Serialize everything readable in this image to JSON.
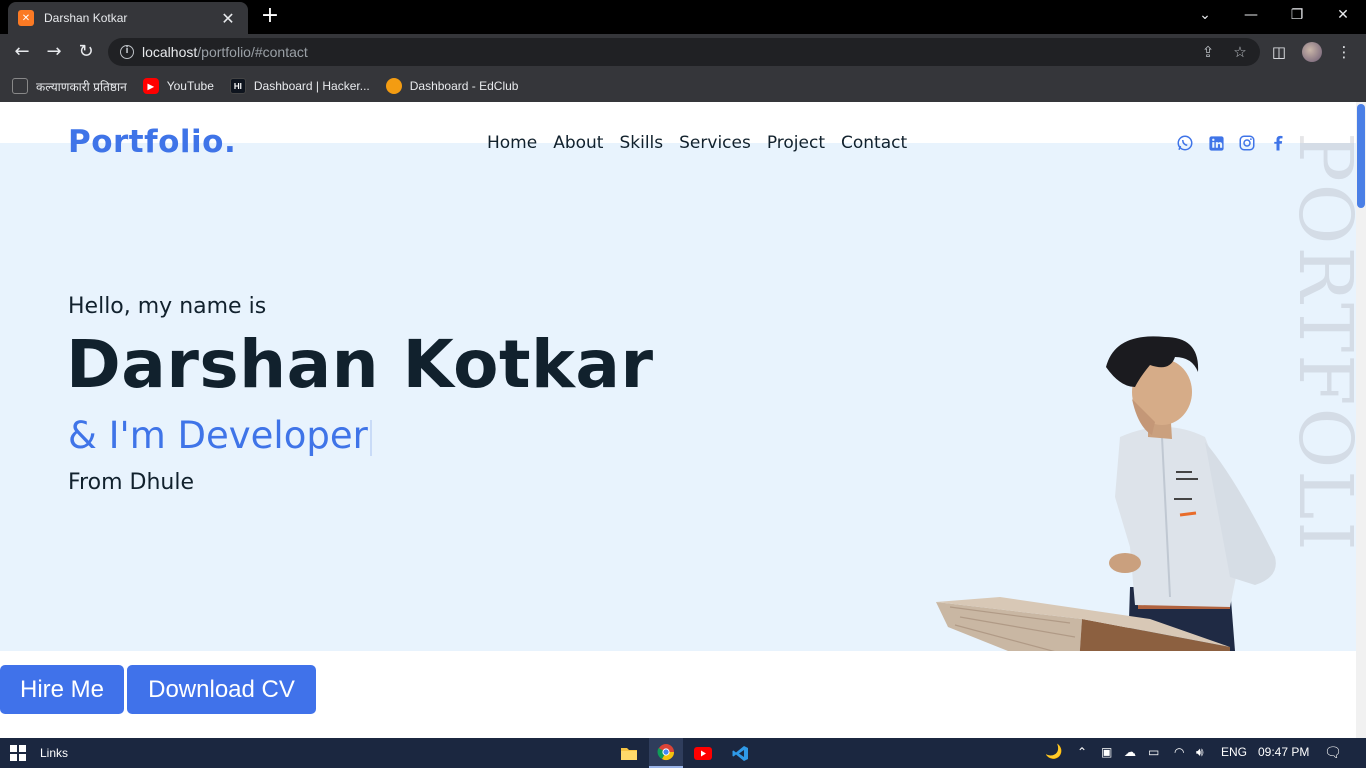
{
  "browser": {
    "tab_title": "Darshan Kotkar",
    "url_host": "localhost",
    "url_path": "/portfolio/#contact",
    "bookmarks": [
      {
        "label": "कल्याणकारी प्रतिष्ठान",
        "icon": "page-icon"
      },
      {
        "label": "YouTube",
        "icon": "youtube-icon"
      },
      {
        "label": "Dashboard | Hacker...",
        "icon": "hackerrank-icon"
      },
      {
        "label": "Dashboard - EdClub",
        "icon": "edclub-icon"
      }
    ]
  },
  "site": {
    "logo": "Portfolio.",
    "nav": [
      "Home",
      "About",
      "Skills",
      "Services",
      "Project",
      "Contact"
    ],
    "socials": [
      "whatsapp-icon",
      "linkedin-icon",
      "instagram-icon",
      "facebook-icon"
    ],
    "watermark": "PORTFOLIO!",
    "hero": {
      "greeting": "Hello, my name is",
      "name": "Darshan Kotkar",
      "role": "& I'm Developer",
      "from": "From Dhule"
    },
    "buttons": {
      "hire": "Hire Me",
      "download": "Download CV"
    },
    "colors": {
      "accent": "#3f74e8",
      "hero_bg": "#e8f3fd",
      "text_dark": "#11212d"
    }
  },
  "taskbar": {
    "label": "Links",
    "language": "ENG",
    "time": "09:47 PM"
  }
}
